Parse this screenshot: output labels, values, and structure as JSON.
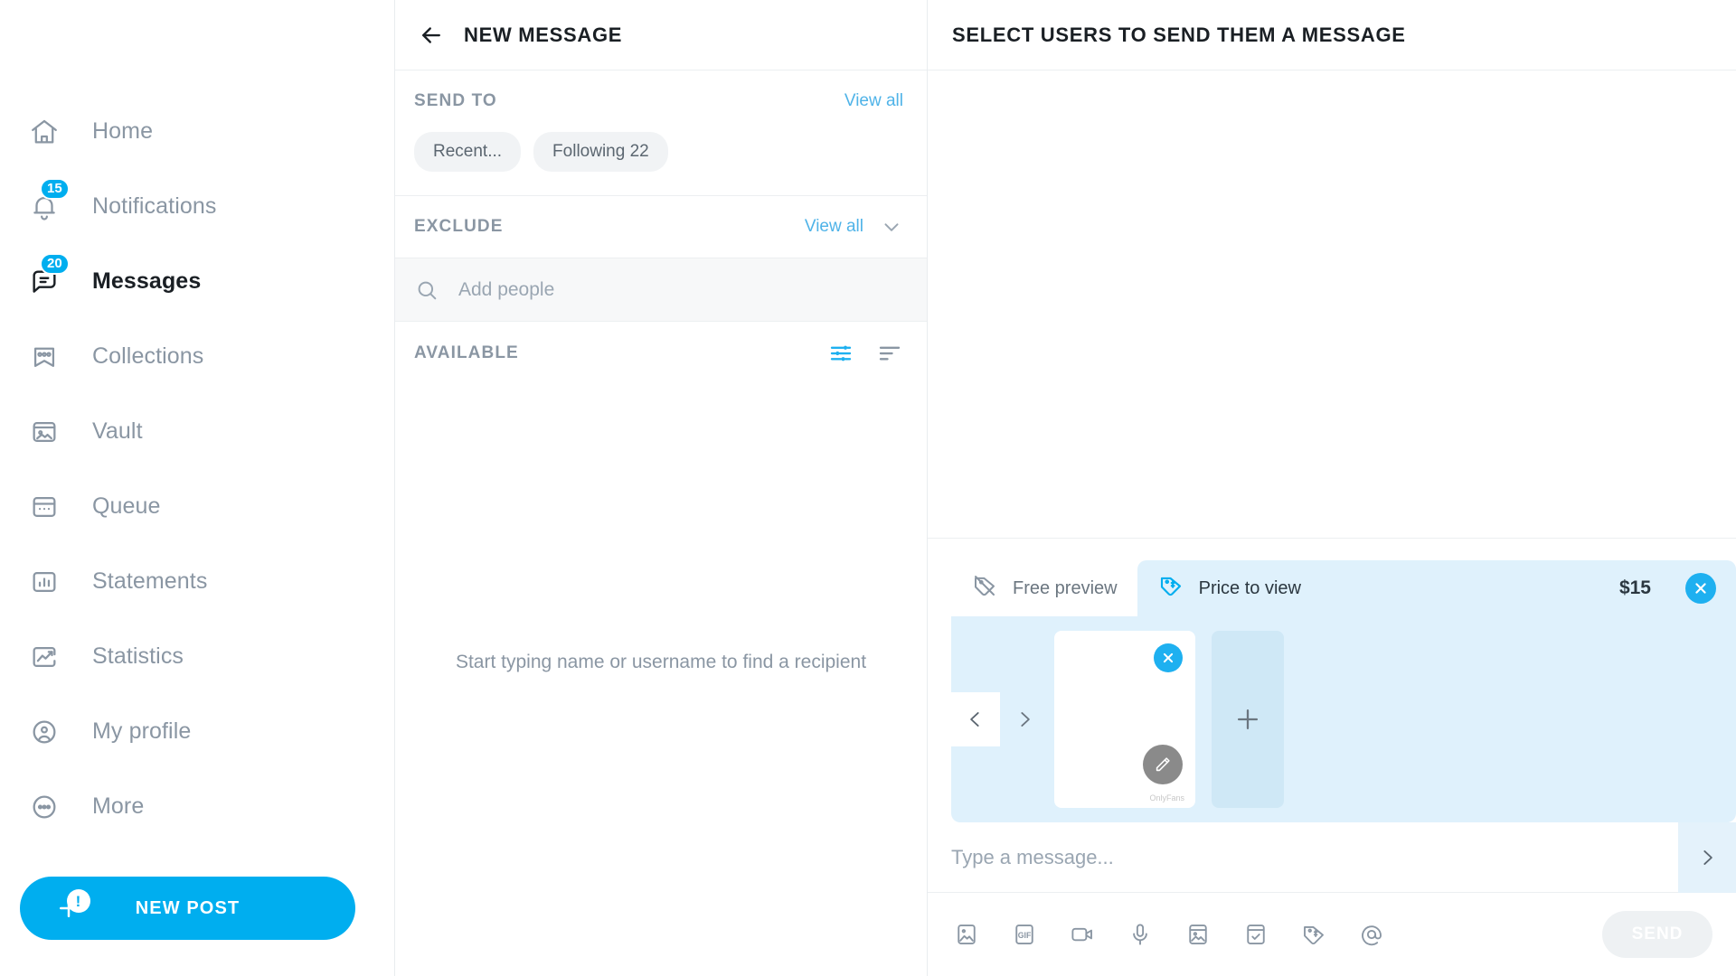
{
  "sidebar": {
    "items": [
      {
        "label": "Home",
        "icon": "home-icon",
        "badge": null,
        "active": false
      },
      {
        "label": "Notifications",
        "icon": "bell-icon",
        "badge": "15",
        "active": false
      },
      {
        "label": "Messages",
        "icon": "message-icon",
        "badge": "20",
        "active": true
      },
      {
        "label": "Collections",
        "icon": "bookmark-star-icon",
        "badge": null,
        "active": false
      },
      {
        "label": "Vault",
        "icon": "vault-image-icon",
        "badge": null,
        "active": false
      },
      {
        "label": "Queue",
        "icon": "calendar-icon",
        "badge": null,
        "active": false
      },
      {
        "label": "Statements",
        "icon": "bar-chart-icon",
        "badge": null,
        "active": false
      },
      {
        "label": "Statistics",
        "icon": "trend-chart-icon",
        "badge": null,
        "active": false
      },
      {
        "label": "My profile",
        "icon": "user-circle-icon",
        "badge": null,
        "active": false
      },
      {
        "label": "More",
        "icon": "ellipsis-circle-icon",
        "badge": null,
        "active": false
      }
    ],
    "new_post": {
      "label": "NEW POST",
      "alert": "!",
      "color": "#00aeef"
    }
  },
  "middle": {
    "title": "NEW MESSAGE",
    "back_icon": "back-arrow-icon",
    "send_to": {
      "title": "SEND TO",
      "view_all": "View all",
      "chips": [
        "Recent...",
        "Following 22"
      ]
    },
    "exclude": {
      "title": "EXCLUDE",
      "view_all": "View all",
      "chevron_icon": "chevron-down-icon"
    },
    "search": {
      "placeholder": "Add people",
      "value": "",
      "icon": "search-icon"
    },
    "available": {
      "title": "AVAILABLE",
      "filter_icon": "filter-sliders-icon",
      "sort_icon": "sort-lines-icon"
    },
    "empty_hint": "Start typing name or username to find a recipient"
  },
  "right": {
    "title": "SELECT USERS TO SEND THEM A MESSAGE",
    "composer": {
      "free_preview": {
        "label": "Free preview",
        "icon": "tag-slash-icon",
        "active": false
      },
      "price_to_view": {
        "label": "Price to view",
        "icon": "price-tag-icon",
        "price": "$15",
        "close_icon": "close-circle-icon",
        "active": true
      },
      "media": {
        "prev_icon": "chevron-left-icon",
        "next_icon": "chevron-right-icon",
        "thumb_close_icon": "close-circle-icon",
        "thumb_edit_icon": "pencil-icon",
        "thumb_watermark": "OnlyFans",
        "add_icon": "plus-icon"
      },
      "message_input": {
        "placeholder": "Type a message...",
        "value": "",
        "expand_icon": "chevron-right-icon"
      },
      "tools": [
        {
          "icon": "photo-icon",
          "name": "attach-photo"
        },
        {
          "icon": "gif-icon",
          "name": "attach-gif"
        },
        {
          "icon": "video-icon",
          "name": "attach-video"
        },
        {
          "icon": "microphone-icon",
          "name": "record-audio"
        },
        {
          "icon": "vault-media-icon",
          "name": "vault-media"
        },
        {
          "icon": "poll-icon",
          "name": "create-poll"
        },
        {
          "icon": "price-tag-icon",
          "name": "set-price"
        },
        {
          "icon": "at-mention-icon",
          "name": "mention-user"
        }
      ],
      "send_label": "SEND"
    }
  },
  "colors": {
    "accent": "#00aeef",
    "accent_light": "#dff1fc",
    "muted": "#8a96a3",
    "text": "#1a1f24"
  }
}
